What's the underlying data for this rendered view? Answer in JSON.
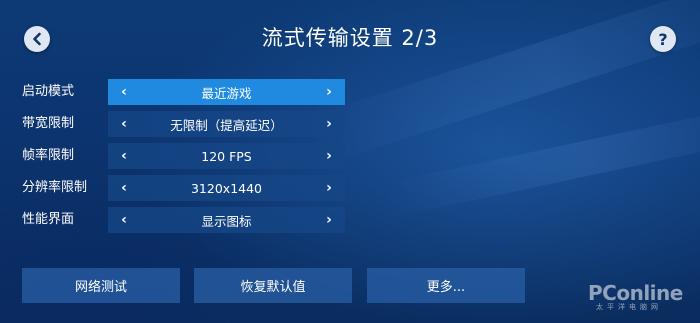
{
  "header": {
    "title": "流式传输设置 2/3",
    "back_icon": "chevron-left-icon",
    "help_label": "?"
  },
  "settings": [
    {
      "label": "启动模式",
      "value": "最近游戏",
      "selected": true
    },
    {
      "label": "带宽限制",
      "value": "无限制（提高延迟）",
      "selected": false
    },
    {
      "label": "帧率限制",
      "value": "120 FPS",
      "selected": false
    },
    {
      "label": "分辨率限制",
      "value": "3120x1440",
      "selected": false
    },
    {
      "label": "性能界面",
      "value": "显示图标",
      "selected": false
    }
  ],
  "arrows": {
    "left": "‹",
    "right": "›"
  },
  "buttons": {
    "network_test": "网络测试",
    "restore_defaults": "恢复默认值",
    "more": "更多..."
  },
  "watermark": {
    "main": "PConline",
    "sub": "太平洋电脑网"
  },
  "colors": {
    "selected_row": "#1f8ae0",
    "row": "#16468a",
    "background": "#0c3470",
    "button": "#285fa5"
  }
}
